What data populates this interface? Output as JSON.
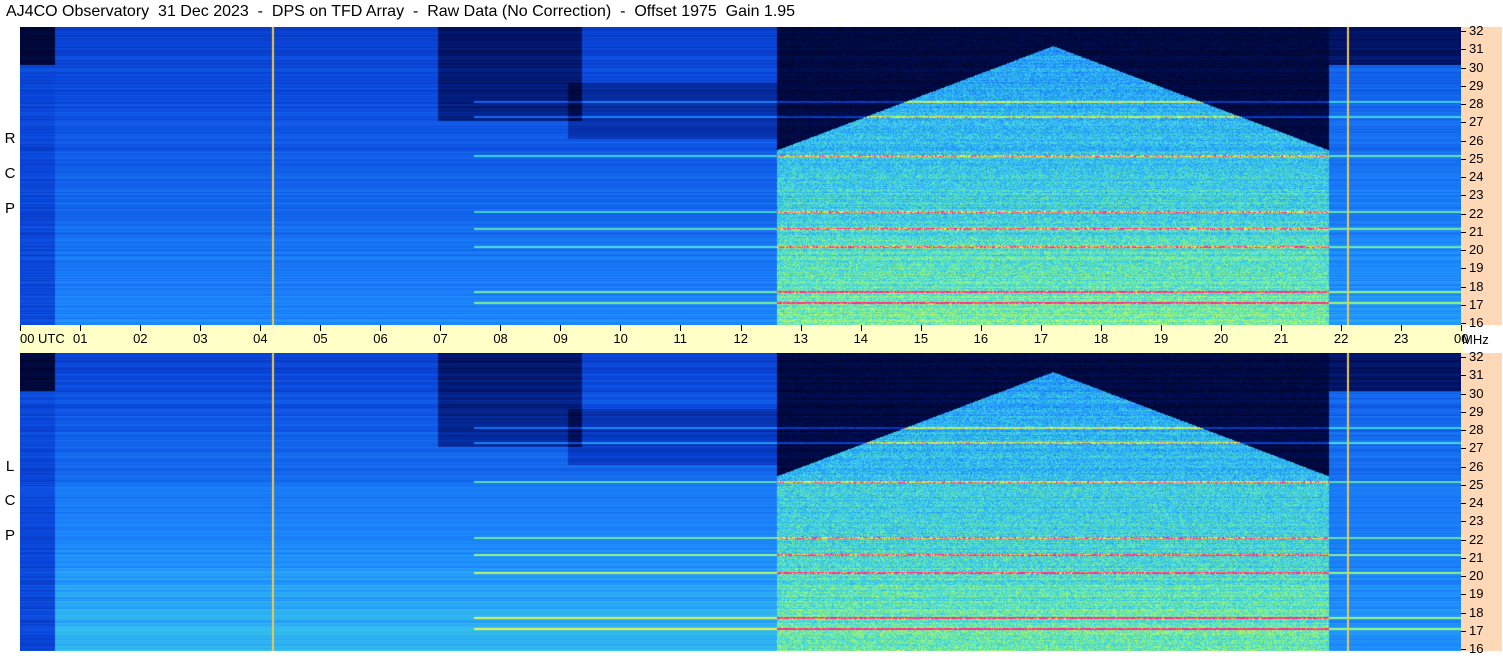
{
  "title": "AJ4CO Observatory  31 Dec 2023  -  DPS on TFD Array  -  Raw Data (No Correction)  -  Offset 1975  Gain 1.95",
  "panels": [
    {
      "id": "rcp",
      "label": [
        "R",
        "C",
        "P"
      ]
    },
    {
      "id": "lcp",
      "label": [
        "L",
        "C",
        "P"
      ]
    }
  ],
  "time_axis": {
    "ticks": [
      "00",
      "01",
      "02",
      "03",
      "04",
      "05",
      "06",
      "07",
      "08",
      "09",
      "10",
      "11",
      "12",
      "13",
      "14",
      "15",
      "16",
      "17",
      "18",
      "19",
      "20",
      "21",
      "22",
      "23",
      "00"
    ],
    "unit": "UTC"
  },
  "freq_axis": {
    "ticks": [
      "16",
      "17",
      "18",
      "19",
      "20",
      "21",
      "22",
      "23",
      "24",
      "25",
      "26",
      "27",
      "28",
      "29",
      "30",
      "31",
      "32"
    ],
    "unit": "MHz"
  },
  "colors": {
    "background": "#ffffff",
    "time_axis_bg": "#ffffc8",
    "freq_axis_bg": "#ffd8b8",
    "spectrogram_low": "#000a28",
    "spectrogram_mid": "#1f6fff",
    "spectrogram_high": "#9cff4a",
    "interference_line": "#ff2a8a",
    "marker_line": "#f2c84a"
  },
  "chart_data": {
    "type": "heatmap",
    "title": "AJ4CO Observatory  31 Dec 2023  -  DPS on TFD Array  -  Raw Data (No Correction)  -  Offset 1975  Gain 1.95",
    "x_range": [
      0,
      24
    ],
    "x_unit": "UTC",
    "y_range": [
      16,
      32
    ],
    "y_unit": "MHz",
    "series": [
      {
        "name": "RCP"
      },
      {
        "name": "LCP"
      }
    ],
    "features": {
      "daytime_onset_utc": 12.6,
      "daytime_end_utc": 21.8,
      "vertical_marker_lines_utc": [
        4.2,
        22.1
      ],
      "strong_band_lines_mhz": [
        17.2,
        17.8,
        20.2,
        21.2,
        22.1,
        25.1,
        27.2,
        28.0
      ]
    }
  }
}
